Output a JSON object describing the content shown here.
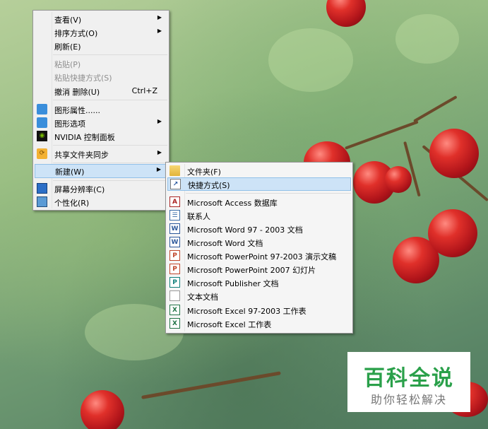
{
  "main_menu": {
    "items": [
      {
        "label": "查看(V)",
        "submenu": true
      },
      {
        "label": "排序方式(O)",
        "submenu": true
      },
      {
        "label": "刷新(E)"
      },
      {
        "label": "粘贴(P)",
        "disabled": true
      },
      {
        "label": "粘贴快捷方式(S)",
        "disabled": true
      },
      {
        "label": "撤消 删除(U)",
        "shortcut": "Ctrl+Z"
      },
      {
        "label": "图形属性......",
        "icon": "graphics-properties-icon"
      },
      {
        "label": "图形选项",
        "icon": "graphics-options-icon",
        "submenu": true
      },
      {
        "label": "NVIDIA 控制面板",
        "icon": "nvidia-icon"
      },
      {
        "label": "共享文件夹同步",
        "icon": "sync-icon",
        "submenu": true
      },
      {
        "label": "新建(W)",
        "submenu": true,
        "highlighted": true
      },
      {
        "label": "屏幕分辨率(C)",
        "icon": "screen-resolution-icon"
      },
      {
        "label": "个性化(R)",
        "icon": "personalize-icon"
      }
    ],
    "arrow": "▶"
  },
  "new_submenu": {
    "items": [
      {
        "label": "文件夹(F)",
        "icon": "folder-icon"
      },
      {
        "label": "快捷方式(S)",
        "icon": "shortcut-icon",
        "highlighted": true
      },
      {
        "label": "Microsoft Access 数据库",
        "icon": "access-icon"
      },
      {
        "label": "联系人",
        "icon": "contact-icon"
      },
      {
        "label": "Microsoft Word 97 - 2003 文档",
        "icon": "word-icon"
      },
      {
        "label": "Microsoft Word 文档",
        "icon": "word-icon"
      },
      {
        "label": "Microsoft PowerPoint 97-2003 演示文稿",
        "icon": "powerpoint-icon"
      },
      {
        "label": "Microsoft PowerPoint 2007 幻灯片",
        "icon": "powerpoint-icon"
      },
      {
        "label": "Microsoft Publisher 文档",
        "icon": "publisher-icon"
      },
      {
        "label": "文本文档",
        "icon": "text-document-icon"
      },
      {
        "label": "Microsoft Excel 97-2003 工作表",
        "icon": "excel-icon"
      },
      {
        "label": "Microsoft Excel 工作表",
        "icon": "excel-icon"
      }
    ]
  },
  "watermark": {
    "title": "百科全说",
    "subtitle": "助你轻松解决"
  },
  "colors": {
    "menu_bg": "#f0f0f0",
    "highlight_bg": "#cde3f7",
    "highlight_border": "#91c0e8",
    "watermark_green": "#2aa04a"
  }
}
